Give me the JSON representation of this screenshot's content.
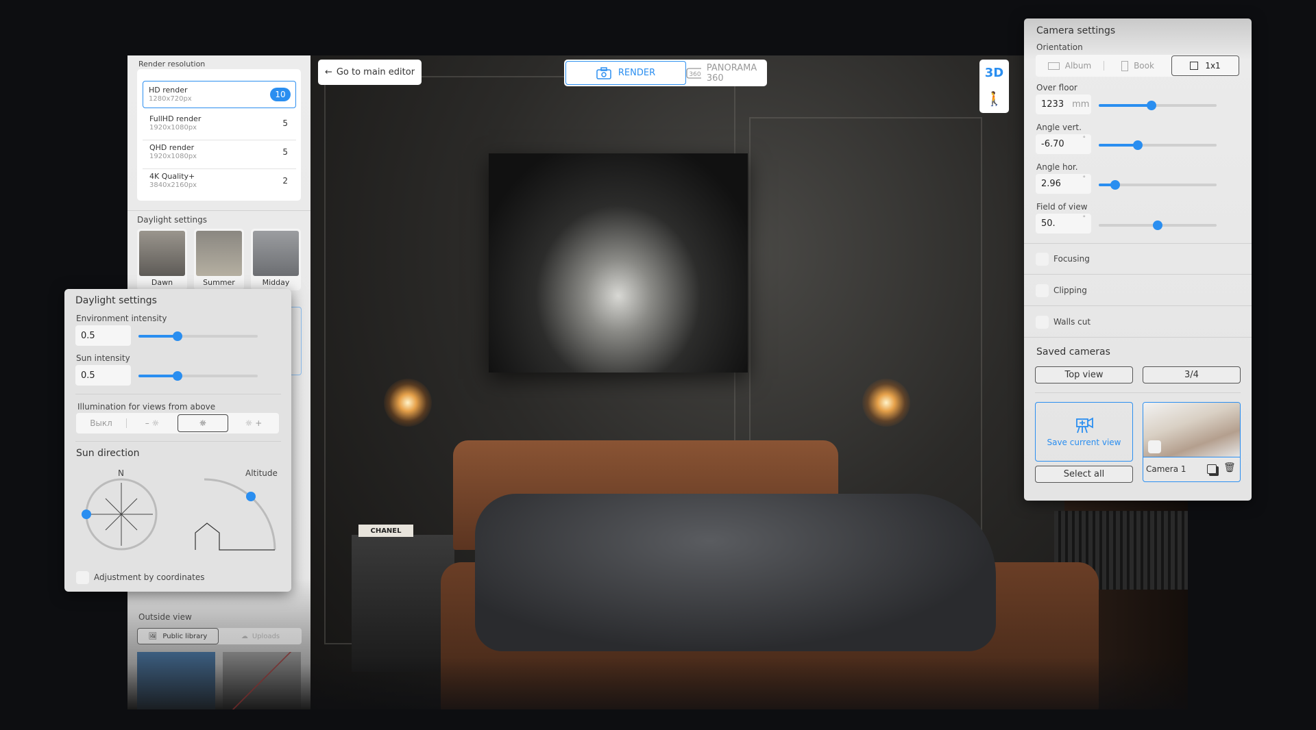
{
  "colors": {
    "accent": "#2a8ef0",
    "panel": "#ebebeb",
    "background": "#0d0e11"
  },
  "topbar": {
    "back_label": "Go to main editor",
    "back_icon": "arrow-left-icon",
    "tabs": [
      {
        "label": "RENDER",
        "icon": "camera-icon",
        "selected": true
      },
      {
        "label": "PANORAMA 360",
        "icon": "panorama-360-icon",
        "selected": false
      }
    ],
    "view_mode": {
      "label_3d": "3D",
      "walk_icon": "walking-person-icon"
    }
  },
  "left_panel": {
    "render_resolution": {
      "title": "Render resolution",
      "items": [
        {
          "name": "HD render",
          "size": "1280x720px",
          "count": "10",
          "selected": true
        },
        {
          "name": "FullHD render",
          "size": "1920x1080px",
          "count": "5"
        },
        {
          "name": "QHD render",
          "size": "1920x1080px",
          "count": "5"
        },
        {
          "name": "4K Quality+",
          "size": "3840x2160px",
          "count": "2"
        }
      ]
    },
    "daylight_presets": {
      "title": "Daylight settings",
      "items": [
        {
          "label": "Dawn"
        },
        {
          "label": "Summer"
        },
        {
          "label": "Midday"
        }
      ]
    },
    "outside_view": {
      "title": "Outside view",
      "tabs": [
        {
          "label": "Public library",
          "icon": "image-icon"
        },
        {
          "label": "Uploads",
          "icon": "cloud-upload-icon"
        }
      ]
    }
  },
  "daylight_popup": {
    "title": "Daylight settings",
    "env_intensity": {
      "label": "Environment intensity",
      "value": "0.5",
      "slider_fraction": 0.33
    },
    "sun_intensity": {
      "label": "Sun intensity",
      "value": "0.5",
      "slider_fraction": 0.33
    },
    "illumination": {
      "label": "Illumination for views from above",
      "options": [
        "Выкл",
        "– ☼",
        "☼",
        "☼ +"
      ],
      "selected": 2
    },
    "sun_direction": {
      "title": "Sun direction",
      "north_label": "N",
      "altitude_label": "Altitude"
    },
    "adjust_coords": {
      "label": "Adjustment by coordinates",
      "checked": false
    }
  },
  "camera_panel": {
    "title": "Camera settings",
    "orientation": {
      "label": "Orientation",
      "options": [
        "Album",
        "Book",
        "1x1"
      ],
      "selected": 2
    },
    "over_floor": {
      "label": "Over floor",
      "value": "1233",
      "unit": "mm",
      "slider_fraction": 0.45
    },
    "angle_vert": {
      "label": "Angle vert.",
      "value": "-6.70",
      "unit": "°",
      "slider_fraction": 0.33
    },
    "angle_hor": {
      "label": "Angle hor.",
      "value": "2.96",
      "unit": "°",
      "slider_fraction": 0.14
    },
    "fov": {
      "label": "Field of view",
      "value": "50.",
      "unit": "°",
      "slider_fraction": 0.5
    },
    "toggles": [
      {
        "label": "Focusing"
      },
      {
        "label": "Clipping"
      },
      {
        "label": "Walls cut"
      }
    ],
    "saved_cameras": {
      "title": "Saved cameras",
      "preset_buttons": [
        "Top view",
        "3/4"
      ],
      "save_label": "Save current view",
      "select_all_label": "Select all",
      "cameras": [
        {
          "name": "Camera 1"
        }
      ]
    }
  },
  "scene": {
    "pillow_text": "CHANEL"
  }
}
